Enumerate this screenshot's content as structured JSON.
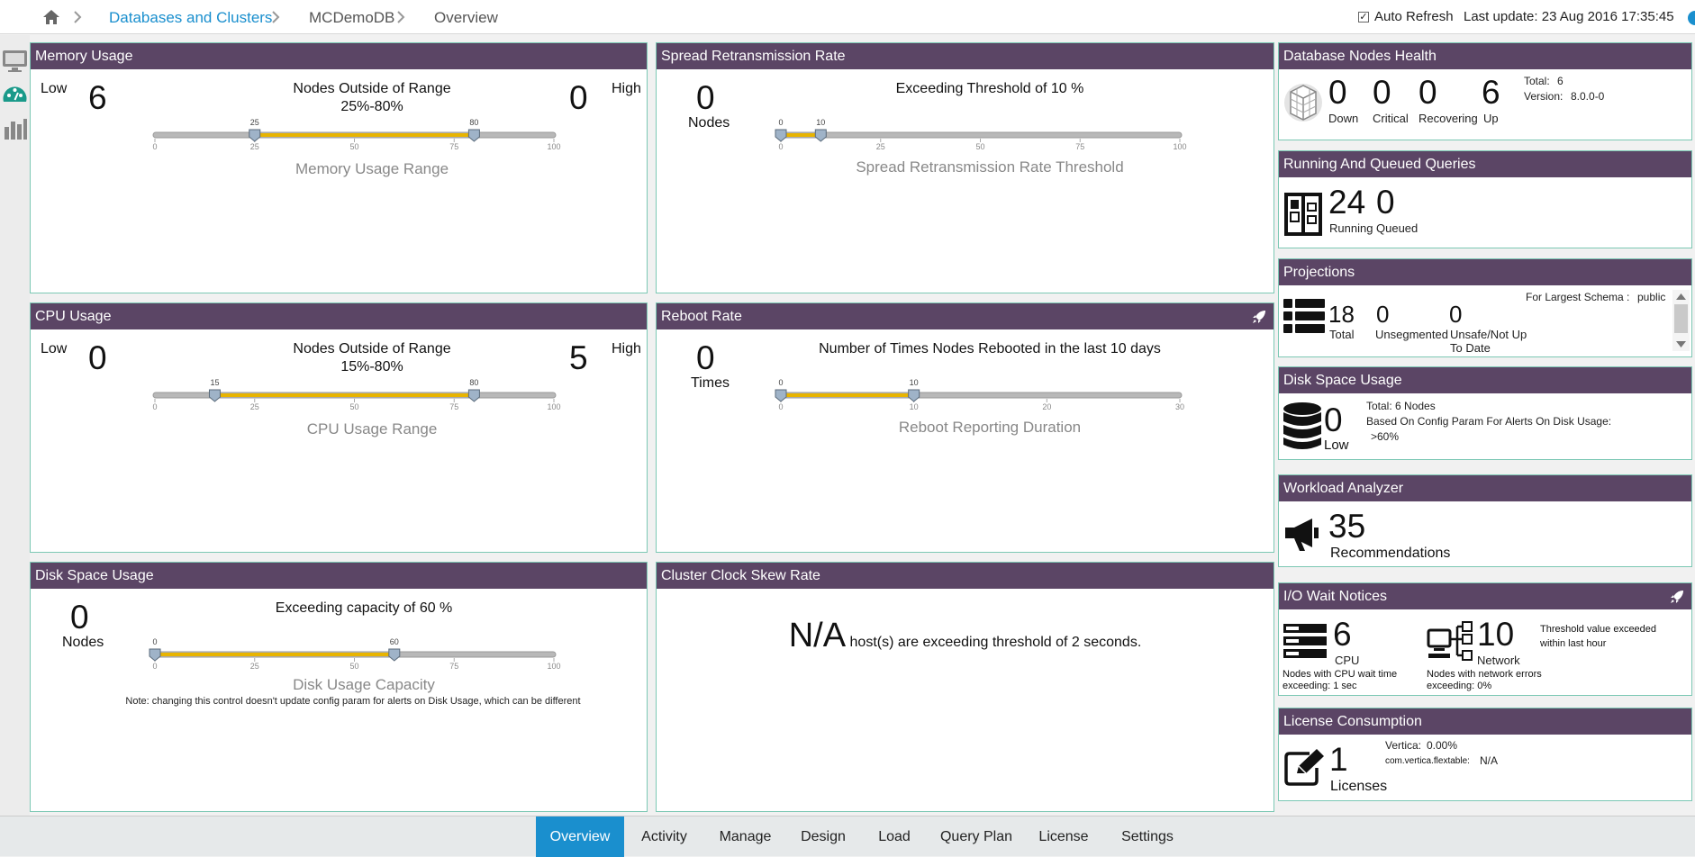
{
  "breadcrumb": [
    "Databases and Clusters",
    "MCDemoDB",
    "Overview"
  ],
  "header": {
    "auto_refresh": "Auto Refresh",
    "last_update": "Last update:  23 Aug 2016 17:35:45"
  },
  "memory": {
    "title": "Memory Usage",
    "low": "Low",
    "low_value": "6",
    "high": "High",
    "high_value": "0",
    "caption1": "Nodes Outside of Range",
    "caption2": "25%-80%",
    "subtitle": "Memory Usage Range",
    "range": [
      25,
      80
    ],
    "max": 100,
    "ticks": [
      "0",
      "25",
      "50",
      "75",
      "100"
    ],
    "handle_labels": [
      "25",
      "80"
    ]
  },
  "spread": {
    "title": "Spread Retransmission Rate",
    "value": "0",
    "unit": "Nodes",
    "caption": "Exceeding Threshold of 10 %",
    "subtitle": "Spread Retransmission Rate Threshold",
    "range": [
      0,
      10
    ],
    "max": 100,
    "ticks": [
      "0",
      "25",
      "50",
      "75",
      "100"
    ],
    "handle_labels": [
      "0",
      "10"
    ]
  },
  "cpu": {
    "title": "CPU Usage",
    "low": "Low",
    "low_value": "0",
    "high": "High",
    "high_value": "5",
    "caption1": "Nodes Outside of Range",
    "caption2": "15%-80%",
    "subtitle": "CPU Usage Range",
    "range": [
      15,
      80
    ],
    "max": 100,
    "ticks": [
      "0",
      "25",
      "50",
      "75",
      "100"
    ],
    "handle_labels": [
      "15",
      "80"
    ]
  },
  "reboot": {
    "title": "Reboot Rate",
    "value": "0",
    "unit": "Times",
    "caption": "Number of Times Nodes Rebooted in the last 10 days",
    "subtitle": "Reboot Reporting Duration",
    "range": [
      0,
      10
    ],
    "max": 30,
    "ticks": [
      "0",
      "10",
      "20",
      "30"
    ],
    "handle_labels": [
      "0",
      "10"
    ]
  },
  "disk": {
    "title": "Disk Space Usage",
    "value": "0",
    "unit": "Nodes",
    "caption": "Exceeding capacity of 60 %",
    "subtitle": "Disk Usage Capacity",
    "note": "Note: changing this control doesn't update config param for alerts on Disk Usage, which can be different",
    "range": [
      0,
      60
    ],
    "max": 100,
    "ticks": [
      "0",
      "25",
      "50",
      "75",
      "100"
    ],
    "handle_labels": [
      "0",
      "60"
    ]
  },
  "clock": {
    "title": "Cluster Clock Skew Rate",
    "value": "N/A",
    "text": "host(s) are exceeding threshold of 2 seconds."
  },
  "right": {
    "health": {
      "title": "Database Nodes Health",
      "down": "0",
      "down_lbl": "Down",
      "critical": "0",
      "critical_lbl": "Critical",
      "recovering": "0",
      "recovering_lbl": "Recovering",
      "up": "6",
      "up_lbl": "Up",
      "total_lbl": "Total:",
      "total": "6",
      "version_lbl": "Version:",
      "version": "8.0.0-0"
    },
    "queries": {
      "title": "Running And Queued Queries",
      "running": "24",
      "running_lbl": "Running",
      "queued": "0",
      "queued_lbl": "Queued"
    },
    "projections": {
      "title": "Projections",
      "schema_lbl": "For Largest Schema :",
      "schema": "public",
      "total": "18",
      "total_lbl": "Total",
      "unseg": "0",
      "unseg_lbl": "Unsegmented",
      "unsafe": "0",
      "unsafe_lbl1": "Unsafe/Not Up",
      "unsafe_lbl2": "To Date"
    },
    "disk": {
      "title": "Disk Space Usage",
      "value": "0",
      "value_lbl": "Low",
      "total": "Total:   6 Nodes",
      "line2": "Based On Config Param For Alerts On Disk Usage:",
      "line3": ">60%"
    },
    "workload": {
      "title": "Workload Analyzer",
      "value": "35",
      "value_lbl": "Recommendations"
    },
    "io": {
      "title": "I/O Wait Notices",
      "cpu": "6",
      "cpu_lbl": "CPU",
      "cpu_note1": "Nodes with CPU wait time",
      "cpu_note2": "exceeding: 1 sec",
      "net": "10",
      "net_lbl": "Network",
      "net_note1": "Nodes with network errors",
      "net_note2": "exceeding: 0%",
      "threshold1": "Threshold value exceeded",
      "threshold2": "within last hour"
    },
    "license": {
      "title": "License Consumption",
      "value": "1",
      "value_lbl": "Licenses",
      "vertica_lbl": "Vertica:",
      "vertica": "0.00%",
      "flex_lbl": "com.vertica.flextable:",
      "flex": "N/A"
    }
  },
  "tabs": [
    "Overview",
    "Activity",
    "Manage",
    "Design",
    "Load",
    "Query Plan",
    "License",
    "Settings"
  ],
  "colors": {
    "header": "#5b4565",
    "accent": "#1a8fce",
    "slider_fill": "#e8b400",
    "panel_border": "#7cc8b4"
  }
}
